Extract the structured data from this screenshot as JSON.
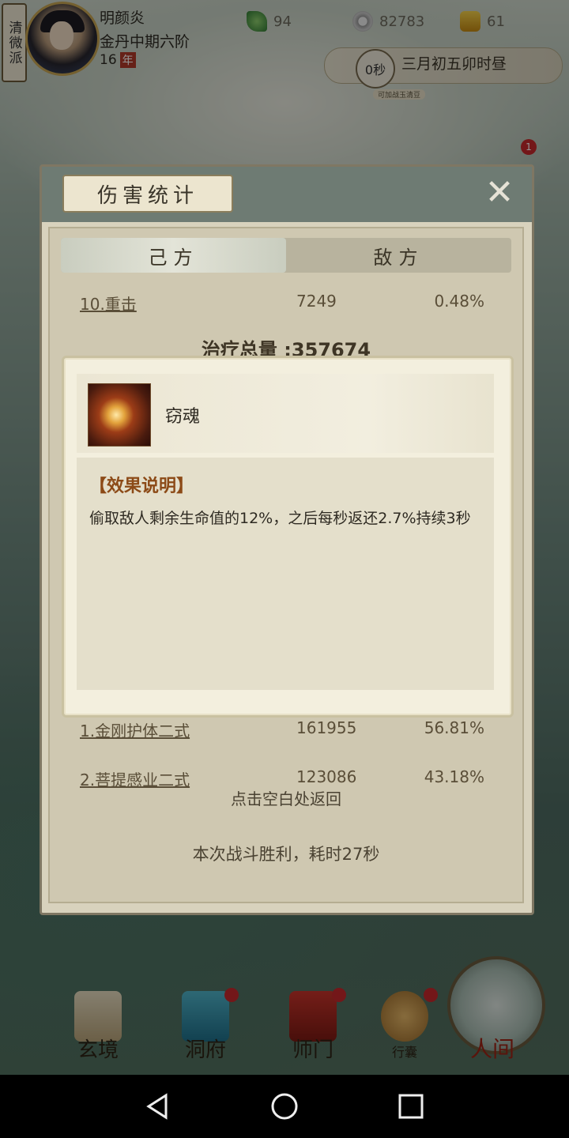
{
  "hud": {
    "sect": "清微派",
    "player_name": "明颜炎",
    "realm": "金丹中期六阶",
    "age": "16",
    "age_unit": "年",
    "jade": "94",
    "coins": "82783",
    "strength": "61",
    "timer": "0秒",
    "date": "三月初五卯时昼",
    "small_tag": "可加战玉清豆",
    "badge_count": "1"
  },
  "stats_panel": {
    "title": "伤害统计",
    "tabs": [
      "己方",
      "敌方"
    ],
    "partial_row": {
      "name": "10.重击",
      "value": "7249",
      "pct": "0.48%"
    },
    "heal_total": "治疗总量 :357674",
    "rows": [
      {
        "name": "1.金刚护体二式",
        "value": "161955",
        "pct": "56.81%"
      },
      {
        "name": "2.菩提感业二式",
        "value": "123086",
        "pct": "43.18%"
      }
    ],
    "back_hint": "点击空白处返回",
    "result": "本次战斗胜利，耗时27秒"
  },
  "popup": {
    "skill_name": "窃魂",
    "effect_title": "【效果说明】",
    "effect_text": "偷取敌人剩余生命值的12%，之后每秒返还2.7%持续3秒"
  },
  "nav": {
    "items": [
      "玄境",
      "洞府",
      "师门",
      "行囊"
    ],
    "world": "人间"
  }
}
